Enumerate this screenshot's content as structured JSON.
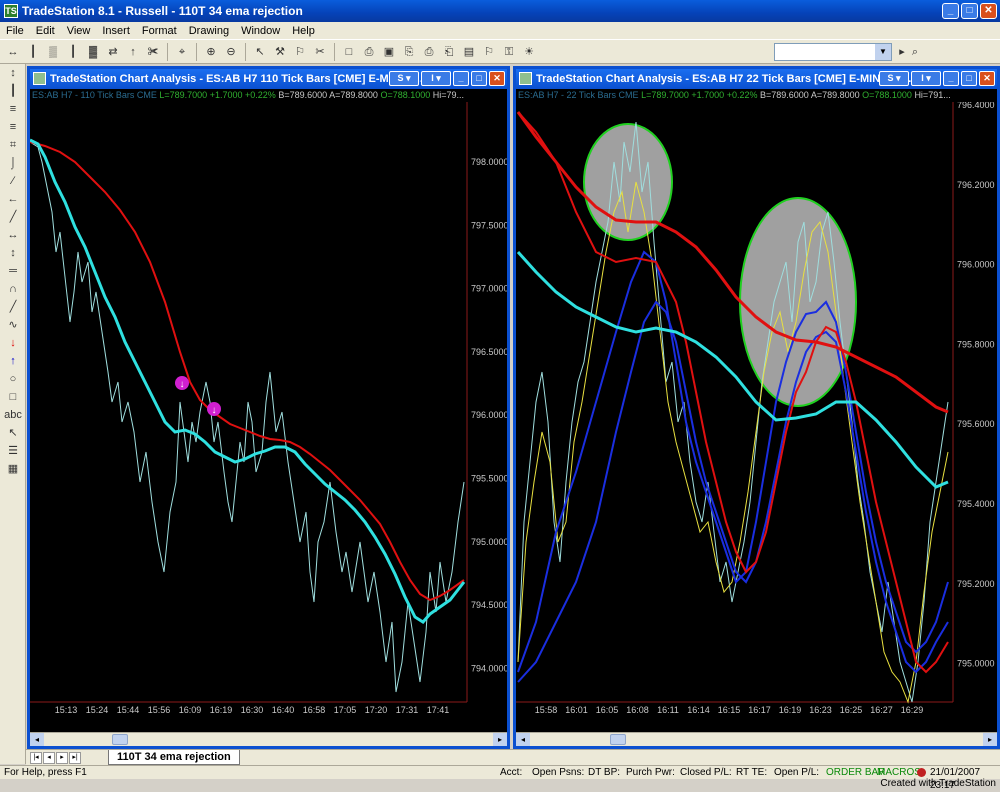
{
  "app": {
    "title": "TradeStation 8.1 - Russell - 110T 34 ema rejection",
    "logo_text": "TS",
    "buttons": [
      "_",
      "□",
      "✕"
    ]
  },
  "menu": [
    "File",
    "Edit",
    "View",
    "Insert",
    "Format",
    "Drawing",
    "Window",
    "Help"
  ],
  "toolbar_icons": [
    "↔",
    "┃",
    "▒",
    "┃",
    "▓",
    "⇄",
    "↑",
    "✀",
    "⌖",
    "⊕",
    "⊖",
    "↖",
    "⚒",
    "⚐",
    "✂",
    "□",
    "⎙",
    "▣",
    "⎘",
    "⎙",
    "⎗",
    "▤",
    "⚐",
    "⚿",
    "☀",
    "▸",
    "⌕"
  ],
  "left_tools": [
    "↕",
    "┃",
    "≡",
    "≡",
    "⌗",
    "⌡",
    "∕",
    "←",
    "╱",
    "↔",
    "↕",
    "═",
    "∩",
    "╱",
    "∿",
    "↓",
    "↑",
    "○",
    "□",
    "abc",
    "↖",
    "☰",
    "▦"
  ],
  "left_chart": {
    "title": "TradeStation Chart Analysis - ES:AB H7  110 Tick Bars [CME] E-MINI R...",
    "status": {
      "symbol": "ES:AB H7 - 110 Tick Bars  CME",
      "last": "L=789.7000",
      "change": "+1.7000",
      "pct": "+0.22%",
      "bid": "B=789.6000",
      "ask": "A=789.8000",
      "open": "O=788.1000",
      "high": "Hi=79..."
    },
    "title_buttons": [
      "S ▾",
      "I ▾",
      "_",
      "□",
      "✕"
    ],
    "price_labels": [
      "798.0000",
      "797.5000",
      "797.0000",
      "796.5000",
      "796.0000",
      "795.5000",
      "795.0000",
      "794.5000",
      "794.0000"
    ],
    "time_labels": [
      "15:13",
      "15:24",
      "15:44",
      "15:56",
      "16:09",
      "16:19",
      "16:30",
      "16:40",
      "16:58",
      "17:05",
      "17:20",
      "17:31",
      "17:41"
    ],
    "markers": [
      "↓",
      "↓"
    ]
  },
  "right_chart": {
    "title": "TradeStation Chart Analysis - ES:AB H7  22 Tick Bars [CME] E-MINI RU...",
    "status": {
      "symbol": "ES:AB H7 - 22 Tick Bars  CME",
      "last": "L=789.7000",
      "change": "+1.7000",
      "pct": "+0.22%",
      "bid": "B=789.6000",
      "ask": "A=789.8000",
      "open": "O=788.1000",
      "high": "Hi=791..."
    },
    "title_buttons": [
      "S ▾",
      "I ▾",
      "_",
      "□",
      "✕"
    ],
    "price_labels": [
      "796.4000",
      "796.2000",
      "796.0000",
      "795.8000",
      "795.6000",
      "795.4000",
      "795.2000",
      "795.0000"
    ],
    "time_labels": [
      "15:58",
      "16:01",
      "16:05",
      "16:08",
      "16:11",
      "16:14",
      "16:15",
      "16:17",
      "16:19",
      "16:23",
      "16:25",
      "16:27",
      "16:29"
    ]
  },
  "tab": {
    "label": "110T 34 ema rejection",
    "nav": [
      "|◂",
      "◂",
      "▸",
      "▸|"
    ]
  },
  "statusbar": {
    "help": "For Help, press F1",
    "acct": "Acct:",
    "open_psns": "Open Psns:",
    "dt_bp": "DT BP:",
    "purch_pwr": "Purch Pwr:",
    "closed_pl": "Closed P/L:",
    "rt_te": "RT TE:",
    "open_pl": "Open P/L:",
    "order_bar": "ORDER BAR",
    "macros": "MACROS",
    "datetime": "21/01/2007 23:17"
  },
  "credit": "Created with TradeStation",
  "colors": {
    "ema_red": "#e01010",
    "ema_cyan": "#2fe0e0",
    "price_line": "#9fdede",
    "blue": "#1a2ee0",
    "yellow": "#e8e040",
    "highlight": "#a0a0a0",
    "highlight_border": "#20d020",
    "marker": "#d020d0"
  }
}
